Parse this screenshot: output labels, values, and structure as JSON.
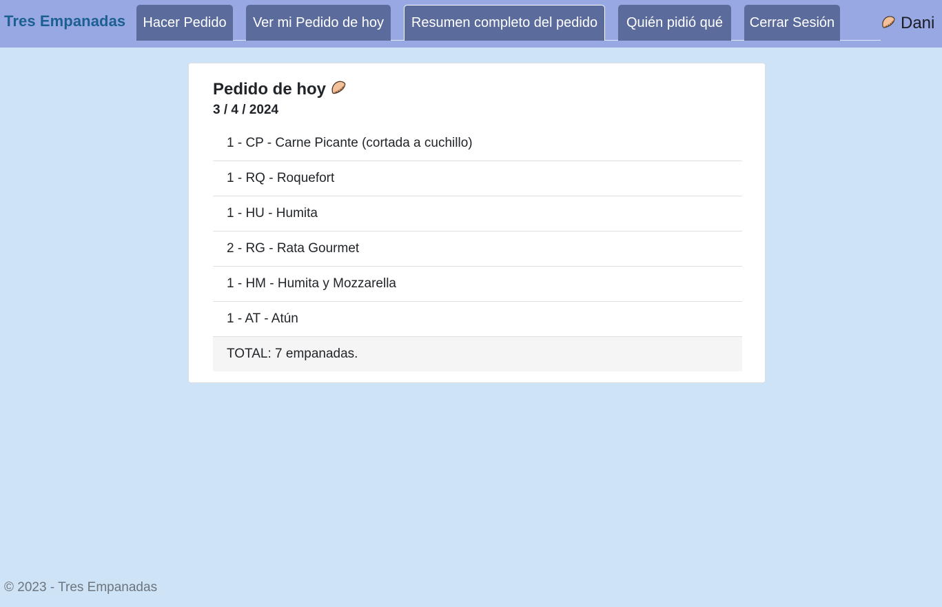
{
  "navbar": {
    "brand": "Tres Empanadas",
    "tabs": [
      {
        "label": "Hacer Pedido"
      },
      {
        "label": "Ver mi Pedido de hoy"
      },
      {
        "label": "Resumen completo del pedido",
        "active": true
      },
      {
        "label": "Quién pidió qué"
      },
      {
        "label": "Cerrar Sesión"
      }
    ],
    "user": {
      "name": "Dani",
      "icon": "empanada-icon"
    }
  },
  "card": {
    "title": "Pedido de hoy",
    "title_icon": "empanada-icon",
    "date": "3 / 4 / 2024",
    "items": [
      {
        "text": "1 - CP - Carne Picante (cortada a cuchillo)"
      },
      {
        "text": "1 - RQ - Roquefort"
      },
      {
        "text": "1 - HU - Humita"
      },
      {
        "text": "2 - RG - Rata Gourmet"
      },
      {
        "text": "1 - HM - Humita y Mozzarella"
      },
      {
        "text": "1 - AT - Atún"
      }
    ],
    "total": "TOTAL: 7 empanadas."
  },
  "footer": {
    "text": "© 2023 - Tres Empanadas"
  },
  "colors": {
    "background": "#cfe3f7",
    "navbar": "#98a8e2",
    "tab": "#5b6b9b",
    "brand": "#1c5f93",
    "card": "#ffffff",
    "total_row": "#f5f5f5"
  }
}
